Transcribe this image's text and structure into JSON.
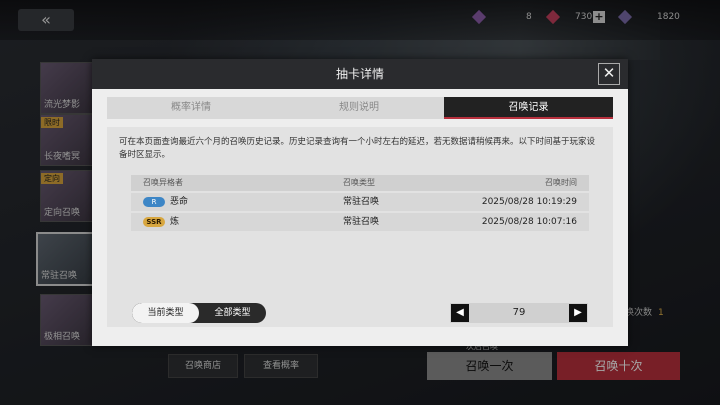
{
  "top_bar": {
    "back_glyph": "«",
    "resource_1": "8",
    "resource_2": "730",
    "resource_3": "1820",
    "plus_glyph": "+",
    "resource_colors": [
      "#8a5ca8",
      "#c2405c",
      "#7a6aa8"
    ]
  },
  "left_banners": [
    {
      "name": "流光梦影",
      "tag": ""
    },
    {
      "name": "长夜嗜冥",
      "tag": "限时"
    },
    {
      "name": "定向召唤",
      "tag": "定向"
    },
    {
      "name": "常驻召唤",
      "tag": ""
    },
    {
      "name": "极相召唤",
      "tag": ""
    }
  ],
  "bottom": {
    "shop_label": "召唤商店",
    "rate_label": "查看概率",
    "one_label": "召唤一次",
    "ten_label": "召唤十次",
    "draw_count_label": "唤次数",
    "draw_count_value": "1",
    "guarantee_text": "次后召唤"
  },
  "modal": {
    "title": "抽卡详情",
    "close_glyph": "✕",
    "tabs": [
      {
        "label": "概率详情",
        "active": false
      },
      {
        "label": "规则说明",
        "active": false
      },
      {
        "label": "召唤记录",
        "active": true
      }
    ],
    "description": "可在本页面查询最近六个月的召唤历史记录。历史记录查询有一个小时左右的延迟，若无数据请稍候再来。以下时间基于玩家设备时区显示。",
    "table": {
      "headers": [
        "召唤异格者",
        "召唤类型",
        "召唤时间"
      ],
      "rows": [
        {
          "rank": "R",
          "name": "恶命",
          "type": "常驻召唤",
          "time": "2025/08/28 10:19:29"
        },
        {
          "rank": "SSR",
          "name": "炼",
          "type": "常驻召唤",
          "time": "2025/08/28 10:07:16"
        }
      ]
    },
    "filter": {
      "current": "当前类型",
      "all": "全部类型"
    },
    "pager": {
      "prev": "◀",
      "page": "79",
      "next": "▶"
    }
  }
}
